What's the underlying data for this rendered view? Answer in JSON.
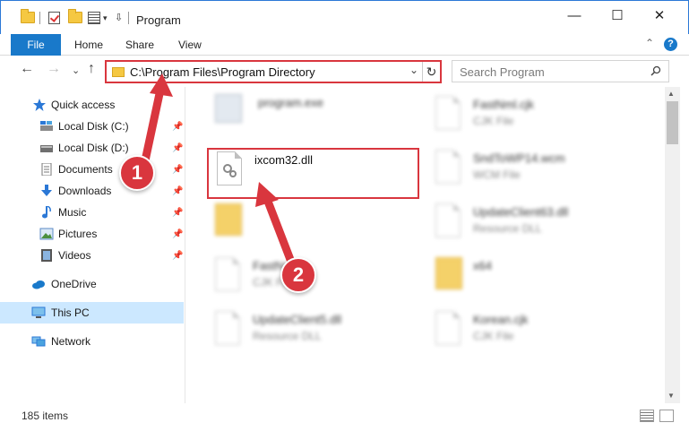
{
  "window": {
    "title": "Program",
    "minimize": "—",
    "maximize": "☐",
    "close": "✕"
  },
  "ribbon": {
    "file": "File",
    "tabs": [
      "Home",
      "Share",
      "View"
    ],
    "help": "?"
  },
  "address": {
    "path": "C:\\Program Files\\Program Directory",
    "dropdown": "⌄",
    "refresh": "↻"
  },
  "search": {
    "placeholder": "Search Program"
  },
  "sidebar": {
    "items": [
      {
        "label": "Quick access",
        "icon": "star-icon"
      },
      {
        "label": "Local Disk (C:)",
        "icon": "disk-icon",
        "pinned": true
      },
      {
        "label": "Local Disk (D:)",
        "icon": "disk-icon",
        "pinned": true
      },
      {
        "label": "Documents",
        "icon": "documents-icon",
        "pinned": true
      },
      {
        "label": "Downloads",
        "icon": "download-icon",
        "pinned": true
      },
      {
        "label": "Music",
        "icon": "music-icon",
        "pinned": true
      },
      {
        "label": "Pictures",
        "icon": "pictures-icon",
        "pinned": true
      },
      {
        "label": "Videos",
        "icon": "videos-icon",
        "pinned": true
      },
      {
        "label": "OneDrive",
        "icon": "cloud-icon"
      },
      {
        "label": "This PC",
        "icon": "computer-icon"
      },
      {
        "label": "Network",
        "icon": "network-icon"
      }
    ]
  },
  "files": {
    "left": [
      {
        "name": "program.exe",
        "type": ""
      },
      {
        "name": "ixcom32.dll",
        "type": ""
      },
      {
        "name": "",
        "type": ""
      },
      {
        "name": "FastNml",
        "type": "CJK File"
      },
      {
        "name": "UpdateClient5.dll",
        "type": "Resource DLL"
      }
    ],
    "right": [
      {
        "name": "FastNml.cjk",
        "type": "CJK File"
      },
      {
        "name": "SndToWP14.wcm",
        "type": "WCM File"
      },
      {
        "name": "UpdateClient63.dll",
        "type": "Resource DLL"
      },
      {
        "name": "x64",
        "type": ""
      },
      {
        "name": "Korean.cjk",
        "type": "CJK File"
      }
    ]
  },
  "status": {
    "count": "185 items"
  },
  "callouts": {
    "one": "1",
    "two": "2"
  },
  "colors": {
    "accent": "#1979ca",
    "callout": "#d9363e",
    "selected": "#cce8ff"
  }
}
